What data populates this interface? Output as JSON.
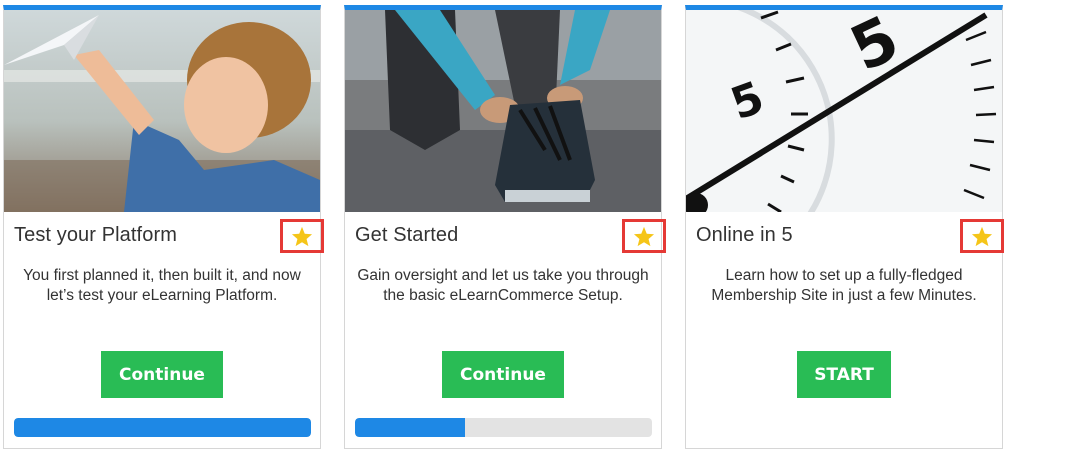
{
  "colors": {
    "accent_blue": "#1e88e5",
    "button_green": "#29bc55",
    "highlight_red": "#e53935",
    "star_yellow": "#f5c518"
  },
  "courses": [
    {
      "title": "Test your Platform",
      "description": "You first planned it, then built it, and now let’s test your eLearning Platform.",
      "button_label": "Continue",
      "favorite_icon": "star-icon",
      "progress": 1.0
    },
    {
      "title": "Get Started",
      "description": "Gain oversight and let us take you through the basic eLearnCommerce Setup.",
      "button_label": "Continue",
      "favorite_icon": "star-icon",
      "progress": 0.37
    },
    {
      "title": "Online in 5",
      "description": "Learn how to set up a fully-fledged Membership Site in just a few Minutes.",
      "button_label": "START",
      "favorite_icon": "star-icon",
      "progress": null
    }
  ]
}
